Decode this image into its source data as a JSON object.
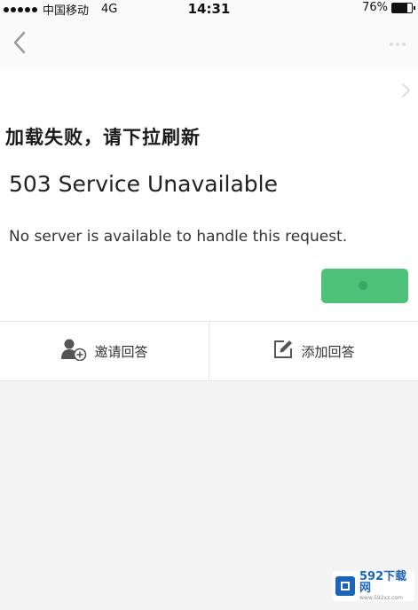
{
  "status_bar": {
    "carrier": "中国移动",
    "network": "4G",
    "time": "14:31",
    "battery_percent": "76%",
    "battery_level": 0.76,
    "signal_bars": 5
  },
  "content": {
    "load_fail_message": "加载失败，请下拉刷新",
    "error_title": "503 Service Unavailable",
    "error_description": "No server is available to handle this request."
  },
  "actions": {
    "invite_label": "邀请回答",
    "add_answer_label": "添加回答"
  },
  "watermark": {
    "brand": "592下载网",
    "sub": "www.592xz.com"
  },
  "colors": {
    "accent_green": "#4cc177",
    "watermark_blue": "#1c64b8"
  },
  "icons": {
    "back": "chevron-left-icon",
    "more": "more-dots-icon",
    "invite": "user-add-icon",
    "edit": "edit-icon"
  }
}
